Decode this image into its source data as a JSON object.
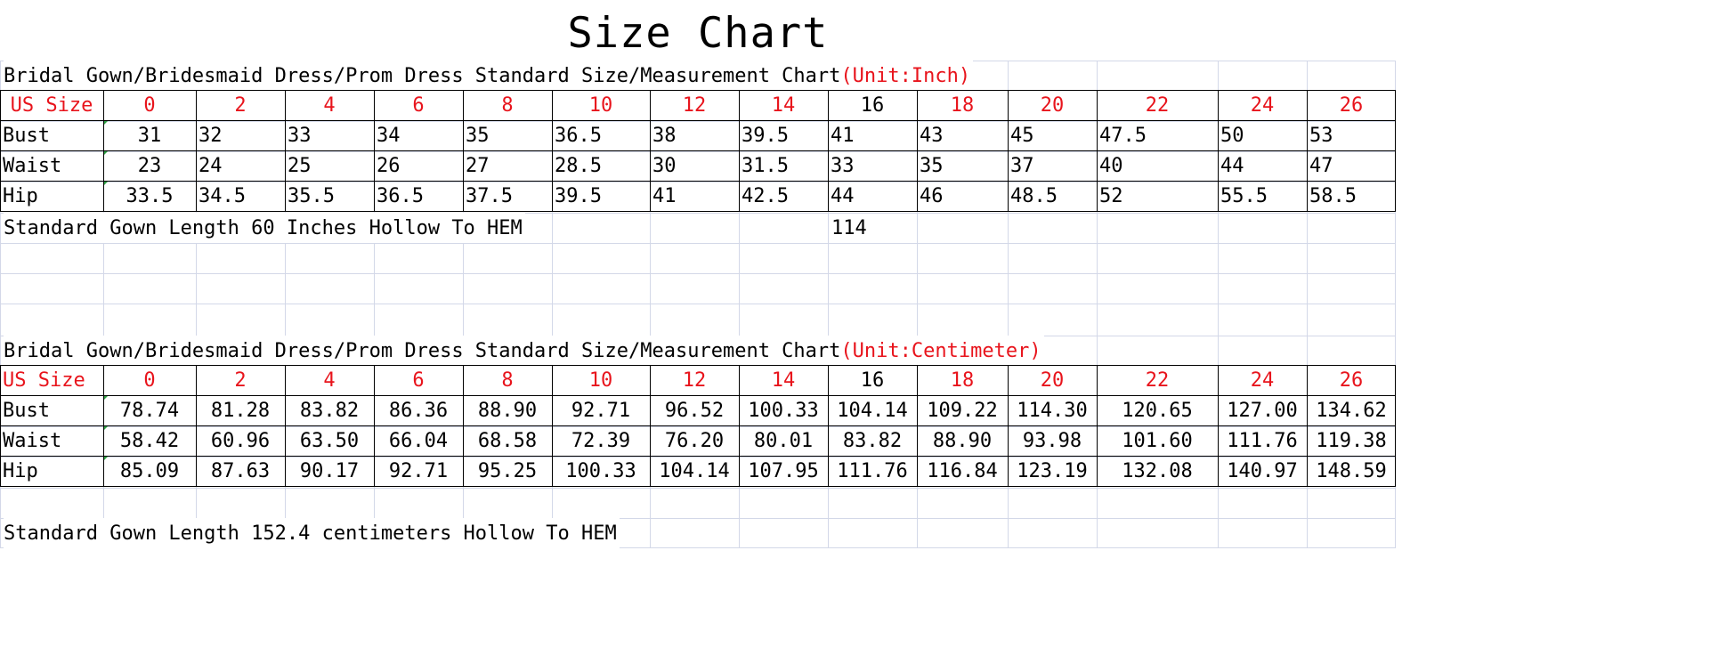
{
  "title": "Size Chart",
  "inch_table": {
    "heading": "Bridal Gown/Bridesmaid Dress/Prom Dress Standard Size/Measurement Chart",
    "unit": "(Unit:Inch)",
    "header_label": "US Size",
    "sizes": [
      "0",
      "2",
      "4",
      "6",
      "8",
      "10",
      "12",
      "14",
      "16",
      "18",
      "20",
      "22",
      "24",
      "26"
    ],
    "rows": [
      {
        "label": "Bust",
        "values": [
          "31",
          "32",
          "33",
          "34",
          "35",
          "36.5",
          "38",
          "39.5",
          "41",
          "43",
          "45",
          "47.5",
          "50",
          "53"
        ]
      },
      {
        "label": "Waist",
        "values": [
          "23",
          "24",
          "25",
          "26",
          "27",
          "28.5",
          "30",
          "31.5",
          "33",
          "35",
          "37",
          "40",
          "44",
          "47"
        ]
      },
      {
        "label": "Hip",
        "values": [
          "33.5",
          "34.5",
          "35.5",
          "36.5",
          "37.5",
          "39.5",
          "41",
          "42.5",
          "44",
          "46",
          "48.5",
          "52",
          "55.5",
          "58.5"
        ]
      }
    ],
    "note": "Standard Gown Length 60 Inches Hollow To HEM",
    "note_extra": "114"
  },
  "cm_table": {
    "heading": "Bridal Gown/Bridesmaid Dress/Prom Dress Standard Size/Measurement Chart",
    "unit": "(Unit:Centimeter)",
    "header_label": "US Size",
    "sizes": [
      "0",
      "2",
      "4",
      "6",
      "8",
      "10",
      "12",
      "14",
      "16",
      "18",
      "20",
      "22",
      "24",
      "26"
    ],
    "rows": [
      {
        "label": "Bust",
        "values": [
          "78.74",
          "81.28",
          "83.82",
          "86.36",
          "88.90",
          "92.71",
          "96.52",
          "100.33",
          "104.14",
          "109.22",
          "114.30",
          "120.65",
          "127.00",
          "134.62"
        ]
      },
      {
        "label": "Waist",
        "values": [
          "58.42",
          "60.96",
          "63.50",
          "66.04",
          "68.58",
          "72.39",
          "76.20",
          "80.01",
          "83.82",
          "88.90",
          "93.98",
          "101.60",
          "111.76",
          "119.38"
        ]
      },
      {
        "label": "Hip",
        "values": [
          "85.09",
          "87.63",
          "90.17",
          "92.71",
          "95.25",
          "100.33",
          "104.14",
          "107.95",
          "111.76",
          "116.84",
          "123.19",
          "132.08",
          "140.97",
          "148.59"
        ]
      }
    ],
    "note": "Standard Gown Length 152.4 centimeters Hollow To HEM"
  },
  "colors": {
    "accent_red": "#e8141c",
    "black_text": "#000000",
    "gridline": "#d3d8e8",
    "cell_marker": "#2ea043"
  }
}
